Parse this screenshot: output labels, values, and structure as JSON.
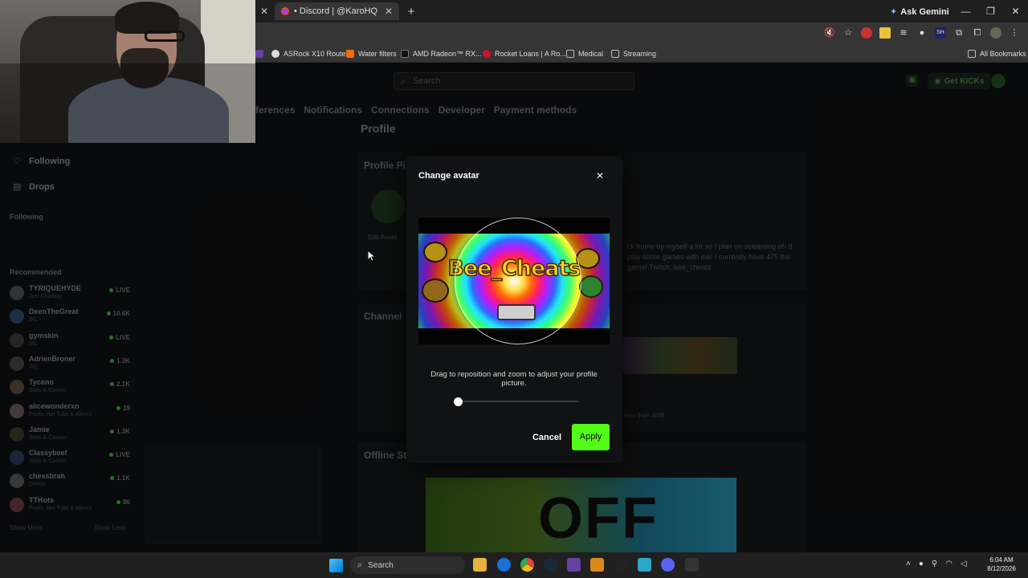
{
  "browser": {
    "tab_close_left": "✕",
    "active_tab": {
      "title": "• Discord | @KaroHQ",
      "close": "✕"
    },
    "new_tab": "+",
    "ask_gemini": "Ask Gemini",
    "window_controls": [
      "—",
      "❐",
      "✕"
    ],
    "bookmarks": [
      {
        "label": "ASRock X10 Router",
        "color": "#dddddd"
      },
      {
        "label": "Water filters",
        "color": "#ff6a00"
      },
      {
        "label": "AMD Radeon™ RX...",
        "color": "#222222"
      },
      {
        "label": "Rocket Loans | A Ro...",
        "color": "#d0102b"
      },
      {
        "label": "Medical",
        "color": "#bbbbbb"
      },
      {
        "label": "Streaming",
        "color": "#bbbbbb"
      }
    ],
    "all_bookmarks": "All Bookmarks"
  },
  "header": {
    "search_placeholder": "Search",
    "kicks_label": "Get KICKs"
  },
  "settings_nav": [
    "ferences",
    "Notifications",
    "Connections",
    "Developer",
    "Payment methods"
  ],
  "profile": {
    "title": "Profile",
    "profile_picture_label": "Profile Pi",
    "edit_avatar": "Edit Avata",
    "about_text": "ck home by myself a lot so I plan on streaming of- d play some games with me! I currently have 475 the game! Twitch: bee_cheats",
    "channel_label": "Channel",
    "size_hint": "less than 4MB",
    "offline_label": "Offline St",
    "offline_banner_text": "OFF"
  },
  "sidebar": {
    "following_link": "Following",
    "drops_link": "Drops",
    "following_head": "Following",
    "recommended_head": "Recommended",
    "channels": [
      {
        "name": "TYRIQUEHYDE",
        "category": "Just Chatting",
        "stat": "LIVE",
        "color": "#4a4d52"
      },
      {
        "name": "DeenTheGreat",
        "category": "IRL",
        "stat": "10.6K",
        "color": "#2a4a6a"
      },
      {
        "name": "gymskin",
        "category": "IRL",
        "stat": "LIVE",
        "color": "#3a3a3a"
      },
      {
        "name": "AdrienBroner",
        "category": "IRL",
        "stat": "1.3K",
        "color": "#444444"
      },
      {
        "name": "Tyceno",
        "category": "Slots & Casino",
        "stat": "2.1K",
        "color": "#5a4a3a"
      },
      {
        "name": "alicewonderxo",
        "category": "Pools, Hot Tubs & Bikinis",
        "stat": "19",
        "color": "#6a5a5a"
      },
      {
        "name": "Jamie",
        "category": "Slots & Casino",
        "stat": "1.3K",
        "color": "#3a3a2a"
      },
      {
        "name": "Classybeef",
        "category": "Slots & Casino",
        "stat": "LIVE",
        "color": "#2a3a5a"
      },
      {
        "name": "chessbrah",
        "category": "Chess",
        "stat": "1.1K",
        "color": "#555555"
      },
      {
        "name": "TTHots",
        "category": "Pools, Hot Tubs & Bikinis",
        "stat": "86",
        "color": "#6a3a3a"
      }
    ],
    "show_more": "Show More",
    "show_less": "Show Less"
  },
  "modal": {
    "title": "Change avatar",
    "close": "✕",
    "banner_text": "Bee_Cheats",
    "hint": "Drag to reposition and zoom to adjust your profile picture.",
    "zoom_level": 0.03,
    "cancel": "Cancel",
    "apply": "Apply",
    "accent_color": "#53fc18"
  },
  "taskbar": {
    "search": "Search",
    "time": "6:04 AM",
    "date": "8/12/2026"
  }
}
